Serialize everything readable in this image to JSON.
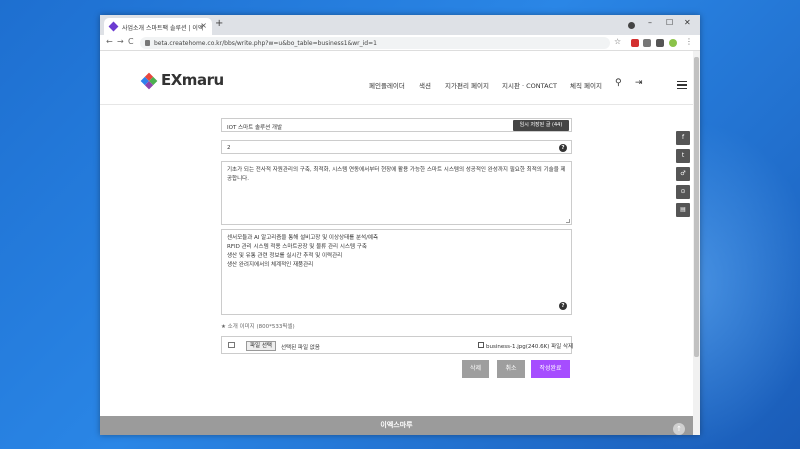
{
  "browser": {
    "tab_title": "사업소개 스마트팩 솔루션 | 이엑",
    "tab_close": "×",
    "new_tab": "+",
    "url": "beta.createhome.co.kr/bbs/write.php?w=u&bo_table=business1&wr_id=1",
    "nav_back": "←",
    "nav_forward": "→",
    "nav_reload": "C",
    "win_minimize": "–",
    "win_maximize": "☐",
    "win_close": "✕",
    "star": "☆"
  },
  "site": {
    "logo": "EXmaru",
    "colors": {
      "logo_red": "#e8473e",
      "logo_green": "#4caf50",
      "logo_blue": "#2f80ed",
      "logo_purple": "#8e44ad"
    },
    "nav": [
      "페인플레이더",
      "색션",
      "지가편리 페이지",
      "지시판 · CONTACT",
      "체직 페이지"
    ],
    "search_icon": "⚲",
    "logout_icon": "⇥",
    "side_icons": [
      "f",
      "t",
      "♂",
      "⊙",
      "▤"
    ]
  },
  "form": {
    "subject_value": "IOT 스마트 솔루션 개발",
    "temp_save_label": "임시 저장된 글 (44)",
    "number_value": "2",
    "help_label": "?",
    "description_value": "기초가 되는 전사적 자원관리의 구축, 최적화, 시스템 연동에서부터 현장에 활용 가능한 스마트 시스템의 성공적인 완성까지 필요한 최적의 기술을 제공합니다.",
    "features": [
      "센서모듈과 AI 알고리즘을 통해 설비고장 및 이상상태를 분석/예측",
      "RFID 관리 시스템 적용 스마트공장 및 물류 관리 시스템 구축",
      "생산 및 유통 관련 정보를 실시간 추적 및 이력관리",
      "생산 완려지에서의 체계적인 재품관리"
    ],
    "image_label": "★ 소개 이미지 (800*533픽셀)",
    "file_button": "파일 선택",
    "file_status": "선택된 파일 없음",
    "delete_label": "business-1.jpg(240.6K) 파일 삭제",
    "buttons": {
      "delete": "삭제",
      "cancel": "취소",
      "submit": "작성완료"
    },
    "button_colors": {
      "delete": "#9e9e9e",
      "cancel": "#9e9e9e",
      "submit": "#a64dff"
    }
  },
  "footer": {
    "title": "이엑스마루",
    "top_icon": "↑"
  }
}
